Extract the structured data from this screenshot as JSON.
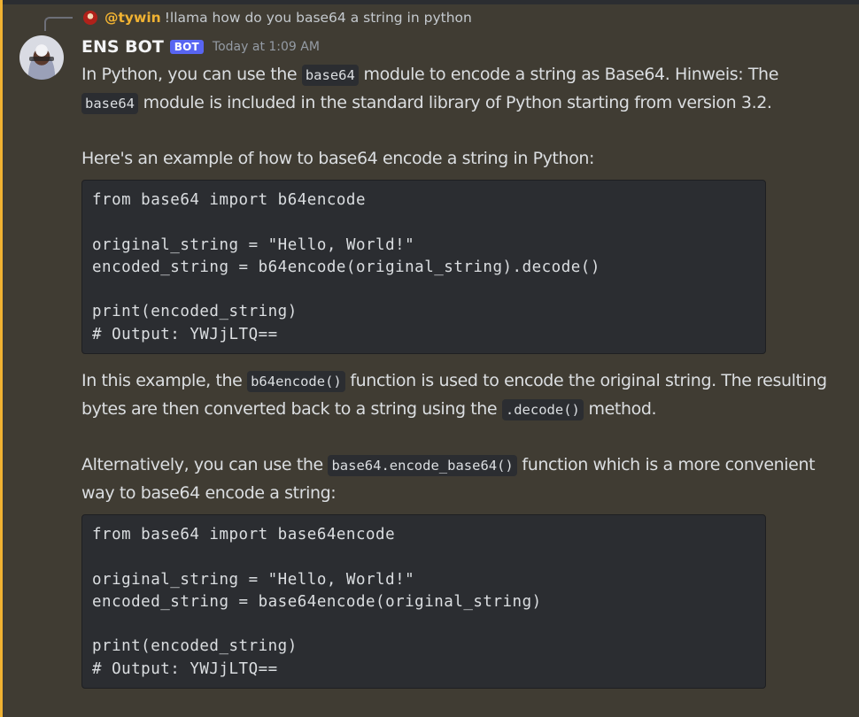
{
  "reply": {
    "username": "@tywin",
    "text": "!llama how do you base64 a string in python"
  },
  "message": {
    "username": "ENS BOT",
    "bot_tag": "BOT",
    "timestamp": "Today at 1:09 AM",
    "paragraph1": {
      "part1": "In Python, you can use the ",
      "code1": "base64",
      "part2": " module to encode a string as Base64. Hinweis: The",
      "code2": "base64",
      "part3": " module is included in the standard library of Python starting from version 3.2."
    },
    "paragraph2": "Here's an example of how to base64 encode a string in Python:",
    "code_block1": [
      "from base64 import b64encode",
      "",
      "original_string = \"Hello, World!\"",
      "encoded_string = b64encode(original_string).decode()",
      "",
      "print(encoded_string)",
      "# Output: YWJjLTQ=="
    ],
    "paragraph3": {
      "part1": "In this example, the ",
      "code1": "b64encode()",
      "part2": " function is used to encode the original string. The resulting bytes are then converted back to a string using the ",
      "code2": ".decode()",
      "part3": " method."
    },
    "paragraph4": {
      "part1": "Alternatively, you can use the ",
      "code1": "base64.encode_base64()",
      "part2": " function which is a more convenient way to base64 encode a string:"
    },
    "code_block2": [
      "from base64 import base64encode",
      "",
      "original_string = \"Hello, World!\"",
      "encoded_string = base64encode(original_string)",
      "",
      "print(encoded_string)",
      "# Output: YWJjLTQ=="
    ]
  },
  "colors": {
    "background": "#403c33",
    "mention_bar": "#f0b232",
    "reply_username": "#f0b232",
    "bot_tag": "#5865f2",
    "code_background": "#2b2d31"
  },
  "icons": {
    "reply_avatar": "avatar-icon",
    "reply_connector": "reply-connector-icon"
  }
}
